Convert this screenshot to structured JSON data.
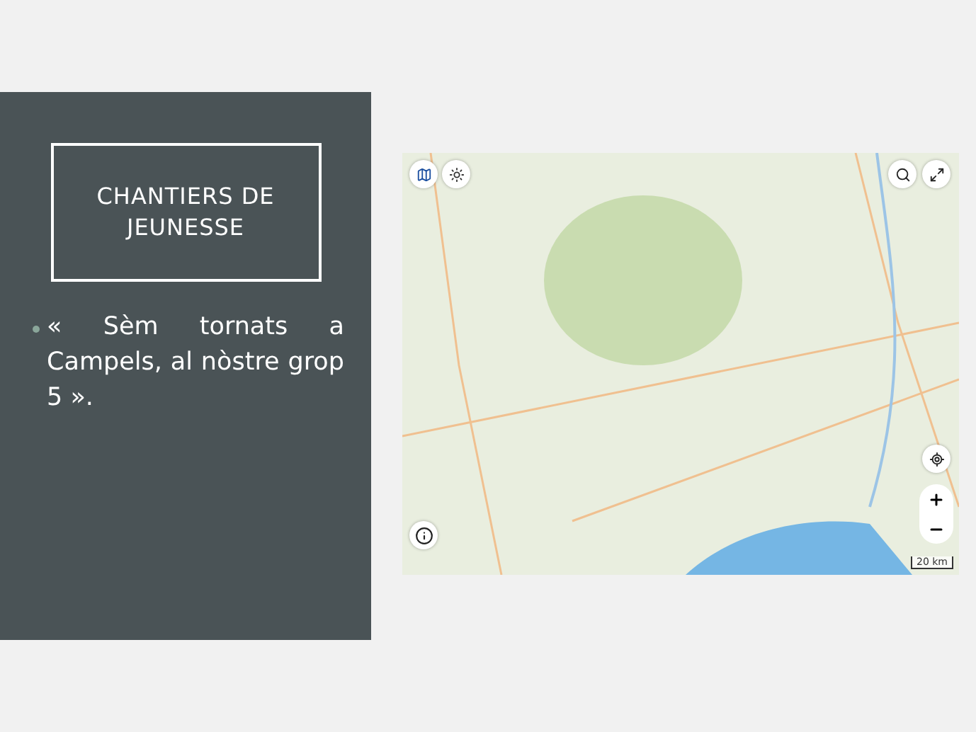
{
  "slide": {
    "title": "CHANTIERS DE JEUNESSE",
    "bullets": [
      "« Sèm tornats a Campels, al nòstre grop 5 »."
    ]
  },
  "map": {
    "scale": "20 km"
  }
}
